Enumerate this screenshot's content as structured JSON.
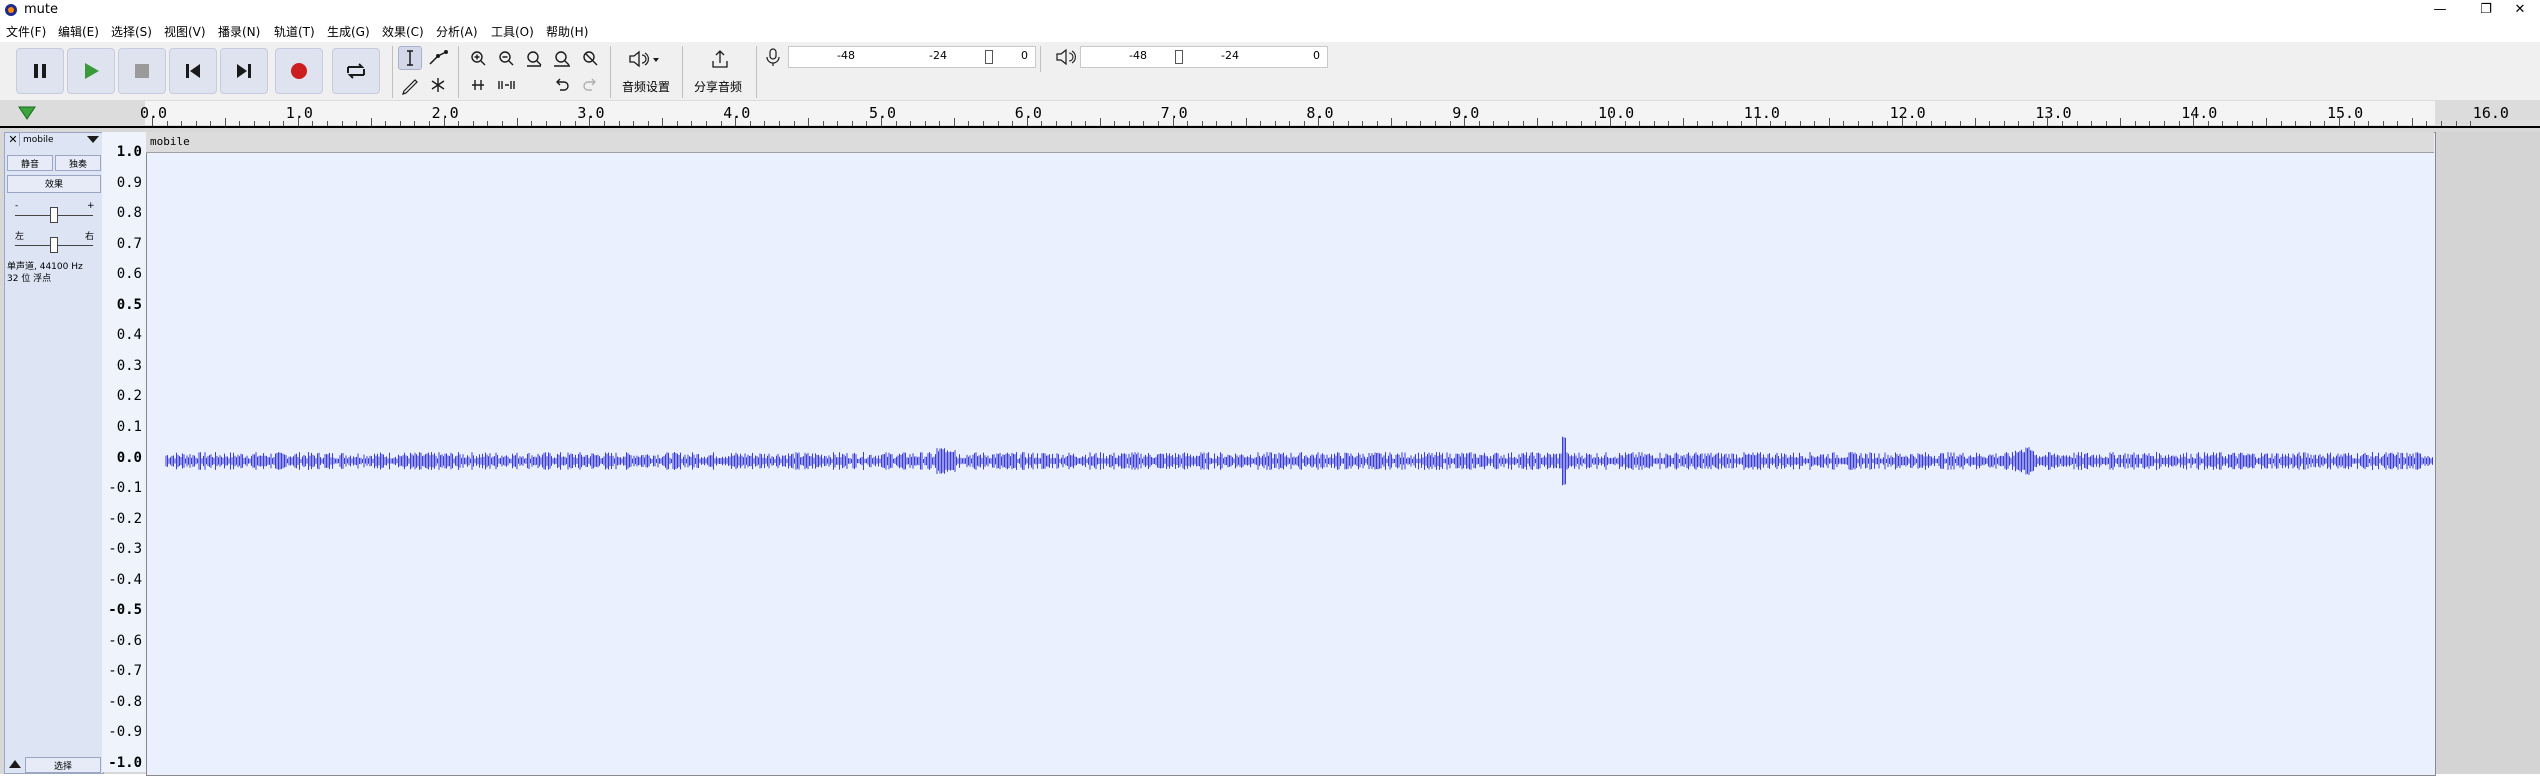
{
  "window": {
    "title": "mute",
    "controls": {
      "minimize": "—",
      "restore": "❐",
      "close": "✕"
    }
  },
  "menu": [
    "文件(F)",
    "编辑(E)",
    "选择(S)",
    "视图(V)",
    "播录(N)",
    "轨道(T)",
    "生成(G)",
    "效果(C)",
    "分析(A)",
    "工具(O)",
    "帮助(H)"
  ],
  "transport": {
    "buttons": [
      "pause-icon",
      "play-icon",
      "stop-icon",
      "skip-start-icon",
      "skip-end-icon",
      "record-icon",
      "loop-icon"
    ],
    "colors": {
      "play": "#3a9a3a",
      "record": "#cc1e1e",
      "icon": "#1a1a1a"
    }
  },
  "audio_setup": {
    "label": "音频设置"
  },
  "share_audio": {
    "label": "分享音频"
  },
  "record_meter": {
    "ticks": [
      "-48",
      "-24",
      "0"
    ]
  },
  "playback_meter": {
    "ticks": [
      "-48",
      "-24",
      "0"
    ]
  },
  "ruler": {
    "labels": [
      "0.0",
      "1.0",
      "2.0",
      "3.0",
      "4.0",
      "5.0",
      "6.0",
      "7.0",
      "8.0",
      "9.0",
      "10.0",
      "11.0",
      "12.0",
      "13.0",
      "14.0",
      "15.0",
      "16.0"
    ]
  },
  "track": {
    "name": "mobile",
    "mute_label": "静音",
    "solo_label": "独奏",
    "effects_label": "效果",
    "gain_minus": "-",
    "gain_plus": "+",
    "pan_left": "左",
    "pan_right": "右",
    "format_line1": "单声道, 44100 Hz",
    "format_line2": "32 位 浮点",
    "select_label": "选择",
    "clip_name": "mobile"
  },
  "vscale": [
    {
      "label": "1.0",
      "bold": true
    },
    {
      "label": "0.9"
    },
    {
      "label": "0.8"
    },
    {
      "label": "0.7"
    },
    {
      "label": "0.6"
    },
    {
      "label": "0.5",
      "bold": true
    },
    {
      "label": "0.4"
    },
    {
      "label": "0.3"
    },
    {
      "label": "0.2"
    },
    {
      "label": "0.1"
    },
    {
      "label": "0.0",
      "bold": true
    },
    {
      "label": "-0.1"
    },
    {
      "label": "-0.2"
    },
    {
      "label": "-0.3"
    },
    {
      "label": "-0.4"
    },
    {
      "label": "-0.5",
      "bold": true
    },
    {
      "label": "-0.6"
    },
    {
      "label": "-0.7"
    },
    {
      "label": "-0.8"
    },
    {
      "label": "-0.9"
    },
    {
      "label": "-1.0",
      "bold": true
    }
  ],
  "waveform": {
    "color": "#3b3bd6"
  },
  "playhead_marker_color": "#3aa53a"
}
